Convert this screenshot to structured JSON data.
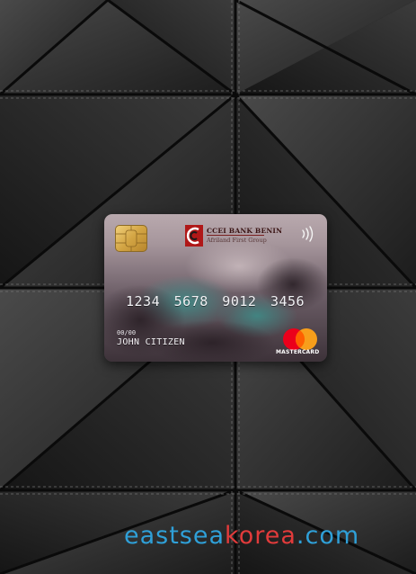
{
  "card": {
    "bank_name": "CCEI BANK BENIN",
    "bank_subtitle": "Afriland First Group",
    "number": "1234 5678 9012 3456",
    "expiry": "00/00",
    "holder": "JOHN CITIZEN",
    "network_label": "MASTERCARD"
  },
  "watermark": {
    "part1": "eastsea",
    "part2": "korea",
    "part3": ".com"
  },
  "colors": {
    "leather": "#2a2a2a",
    "watermark_blue": "#2fa0d8",
    "watermark_red": "#e23b3b",
    "mastercard_red": "#eb001b",
    "mastercard_yellow": "#f79e1b"
  },
  "icons": [
    "emv-chip-icon",
    "bank-logo-icon",
    "contactless-icon",
    "mastercard-logo-icon"
  ]
}
